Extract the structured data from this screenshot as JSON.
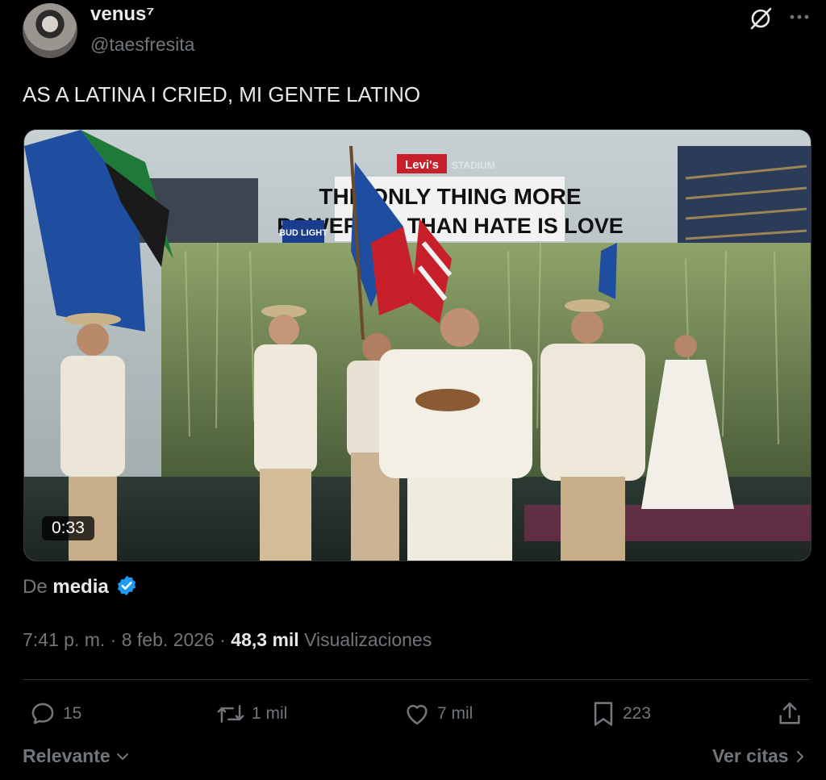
{
  "author": {
    "display_name": "venus⁷",
    "handle": "@taesfresita"
  },
  "tweet": {
    "text": "AS A LATINA I CRIED, MI GENTE LATINO"
  },
  "media": {
    "duration": "0:33",
    "sign_line1": "THE ONLY THING MORE",
    "sign_line2": "POWERFUL THAN HATE IS LOVE",
    "sign_brand": "Levi's",
    "sign_sub": "STADIUM",
    "small_sign": "BUD LIGHT"
  },
  "source": {
    "prefix": "De",
    "name": "media"
  },
  "meta": {
    "time": "7:41 p. m.",
    "separator": "·",
    "date": "8 feb. 2026",
    "views_count": "48,3 mil",
    "views_label": "Visualizaciones"
  },
  "actions": {
    "replies": "15",
    "reposts": "1 mil",
    "likes": "7 mil",
    "bookmarks": "223"
  },
  "footer": {
    "sort_label": "Relevante",
    "quotes_label": "Ver citas"
  },
  "colors": {
    "background": "#000000",
    "text": "#e7e9ea",
    "secondary": "#71767b",
    "divider": "#2f3336",
    "verified": "#1d9bf0"
  }
}
